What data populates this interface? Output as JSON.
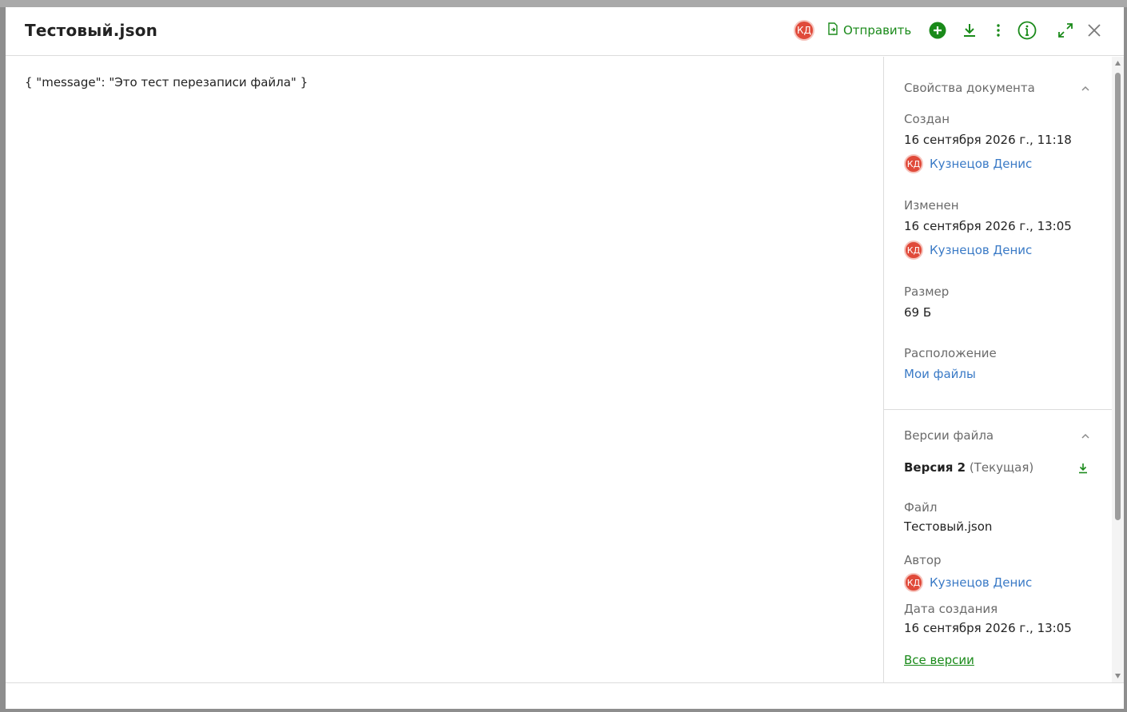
{
  "header": {
    "title": "Тестовый.json",
    "avatar_initials": "КД",
    "send_label": "Отправить",
    "accent_color": "#1a8a1a"
  },
  "content": {
    "text": "{ \"message\": \"Это тест перезаписи файла\" }"
  },
  "properties": {
    "heading": "Свойства документа",
    "created_label": "Создан",
    "created_date": "16 сентября 2026 г., 11:18",
    "created_by": "Кузнецов Денис",
    "modified_label": "Изменен",
    "modified_date": "16 сентября 2026 г., 13:05",
    "modified_by": "Кузнецов Денис",
    "size_label": "Размер",
    "size_value": "69 Б",
    "location_label": "Расположение",
    "location_value": "Мои файлы"
  },
  "versions": {
    "heading": "Версии файла",
    "version_label": "Версия 2",
    "version_current": "(Текущая)",
    "file_label": "Файл",
    "file_value": "Тестовый.json",
    "author_label": "Автор",
    "author_value": "Кузнецов Денис",
    "date_label": "Дата создания",
    "date_value": "16 сентября 2026 г., 13:05",
    "all_versions": "Все версии"
  },
  "avatar_initials": "КД",
  "icons": [
    "send-file-icon",
    "add-icon",
    "download-icon",
    "more-icon",
    "info-icon",
    "expand-icon",
    "close-icon",
    "chevron-up-icon"
  ]
}
